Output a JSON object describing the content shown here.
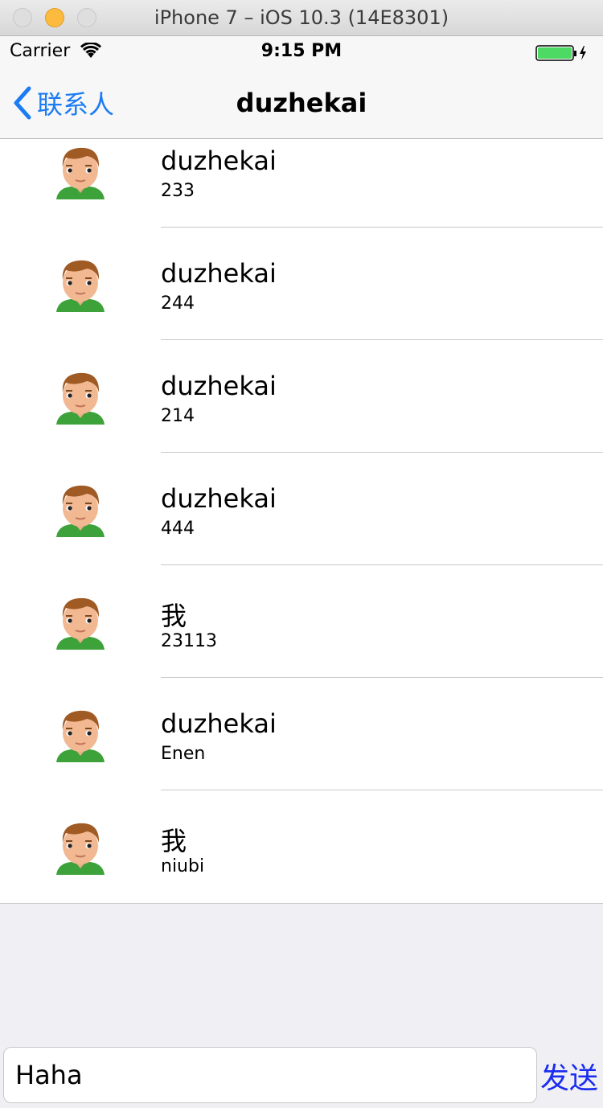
{
  "window": {
    "title": "iPhone 7 – iOS 10.3 (14E8301)"
  },
  "status_bar": {
    "carrier": "Carrier",
    "time": "9:15 PM",
    "battery_color": "#4cd964"
  },
  "nav": {
    "back_label": "联系人",
    "title": "duzhekai",
    "accent_color": "#1b7cf4"
  },
  "messages": [
    {
      "name": "duzhekai",
      "text": "233"
    },
    {
      "name": "duzhekai",
      "text": "244"
    },
    {
      "name": "duzhekai",
      "text": "214"
    },
    {
      "name": "duzhekai",
      "text": "444"
    },
    {
      "name": "我",
      "text": "23113"
    },
    {
      "name": "duzhekai",
      "text": "Enen"
    },
    {
      "name": "我",
      "text": "niubi"
    }
  ],
  "input": {
    "value": "Haha",
    "send_label": "发送",
    "send_color": "#1b2cf0"
  }
}
